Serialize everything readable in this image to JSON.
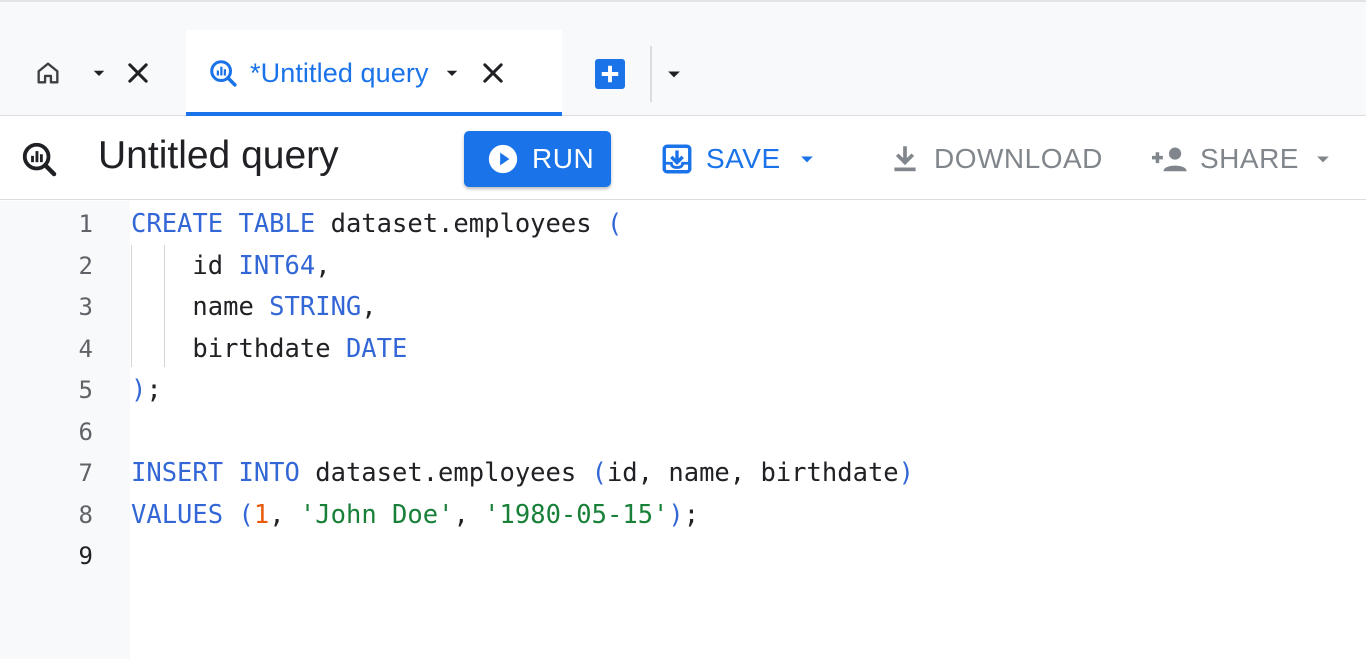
{
  "tabs": {
    "home": {
      "icon": "home-icon"
    },
    "query": {
      "label": "*Untitled query",
      "icon": "query-icon"
    },
    "new_tab_icon": "add-box-icon"
  },
  "toolbar": {
    "title": "Untitled query",
    "run_label": "RUN",
    "save_label": "SAVE",
    "download_label": "DOWNLOAD",
    "share_label": "SHARE"
  },
  "editor": {
    "line_numbers": [
      "1",
      "2",
      "3",
      "4",
      "5",
      "6",
      "7",
      "8",
      "9"
    ],
    "active_line": 9,
    "lines": [
      [
        {
          "t": "CREATE TABLE",
          "c": "kw"
        },
        {
          "t": " dataset.employees ",
          "c": ""
        },
        {
          "t": "(",
          "c": "kw"
        }
      ],
      [
        {
          "t": "    id ",
          "c": ""
        },
        {
          "t": "INT64",
          "c": "kw"
        },
        {
          "t": ",",
          "c": ""
        }
      ],
      [
        {
          "t": "    name ",
          "c": ""
        },
        {
          "t": "STRING",
          "c": "kw"
        },
        {
          "t": ",",
          "c": ""
        }
      ],
      [
        {
          "t": "    birthdate ",
          "c": ""
        },
        {
          "t": "DATE",
          "c": "kw"
        }
      ],
      [
        {
          "t": ")",
          "c": "kw"
        },
        {
          "t": ";",
          "c": ""
        }
      ],
      [],
      [
        {
          "t": "INSERT INTO",
          "c": "kw"
        },
        {
          "t": " dataset.employees ",
          "c": ""
        },
        {
          "t": "(",
          "c": "kw"
        },
        {
          "t": "id, name, birthdate",
          "c": ""
        },
        {
          "t": ")",
          "c": "kw"
        }
      ],
      [
        {
          "t": "VALUES",
          "c": "kw"
        },
        {
          "t": " ",
          "c": ""
        },
        {
          "t": "(",
          "c": "kw"
        },
        {
          "t": "1",
          "c": "num"
        },
        {
          "t": ", ",
          "c": ""
        },
        {
          "t": "'John Doe'",
          "c": "str"
        },
        {
          "t": ", ",
          "c": ""
        },
        {
          "t": "'1980-05-15'",
          "c": "str"
        },
        {
          "t": ")",
          "c": "kw"
        },
        {
          "t": ";",
          "c": ""
        }
      ],
      []
    ]
  },
  "colors": {
    "accent": "#1a73e8",
    "keyword": "#3367d6",
    "string": "#188038",
    "number": "#e8590c",
    "disabled": "#80868b"
  }
}
